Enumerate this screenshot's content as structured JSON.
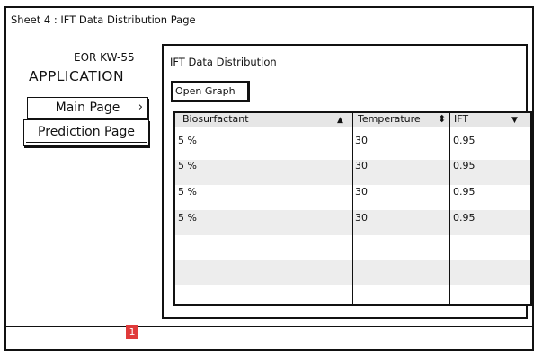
{
  "window": {
    "title": "Sheet 4 : IFT Data Distribution Page"
  },
  "sidebar": {
    "subtitle": "EOR KW-55",
    "title": "APPLICATION",
    "items": [
      {
        "label": "Main Page",
        "chevron": "›"
      },
      {
        "label": "Prediction Page"
      }
    ]
  },
  "panel": {
    "title": "IFT Data Distribution",
    "graph_button": "Open Graph",
    "table": {
      "columns": [
        {
          "label": "Biosurfactant",
          "sort_icon": "▲"
        },
        {
          "label": "Temperature",
          "sort_icon": "⬍"
        },
        {
          "label": "IFT",
          "sort_icon": "▼"
        }
      ],
      "rows": [
        [
          "5 %",
          "30",
          "0.95"
        ],
        [
          "5 %",
          "30",
          "0.95"
        ],
        [
          "5 %",
          "30",
          "0.95"
        ],
        [
          "5 %",
          "30",
          "0.95"
        ]
      ]
    }
  },
  "footer": {
    "badge": "1"
  },
  "colors": {
    "badge": "#e03a3a",
    "header_bg": "#e6e6e6",
    "alt_row": "#ededed",
    "stroke": "#111111"
  }
}
